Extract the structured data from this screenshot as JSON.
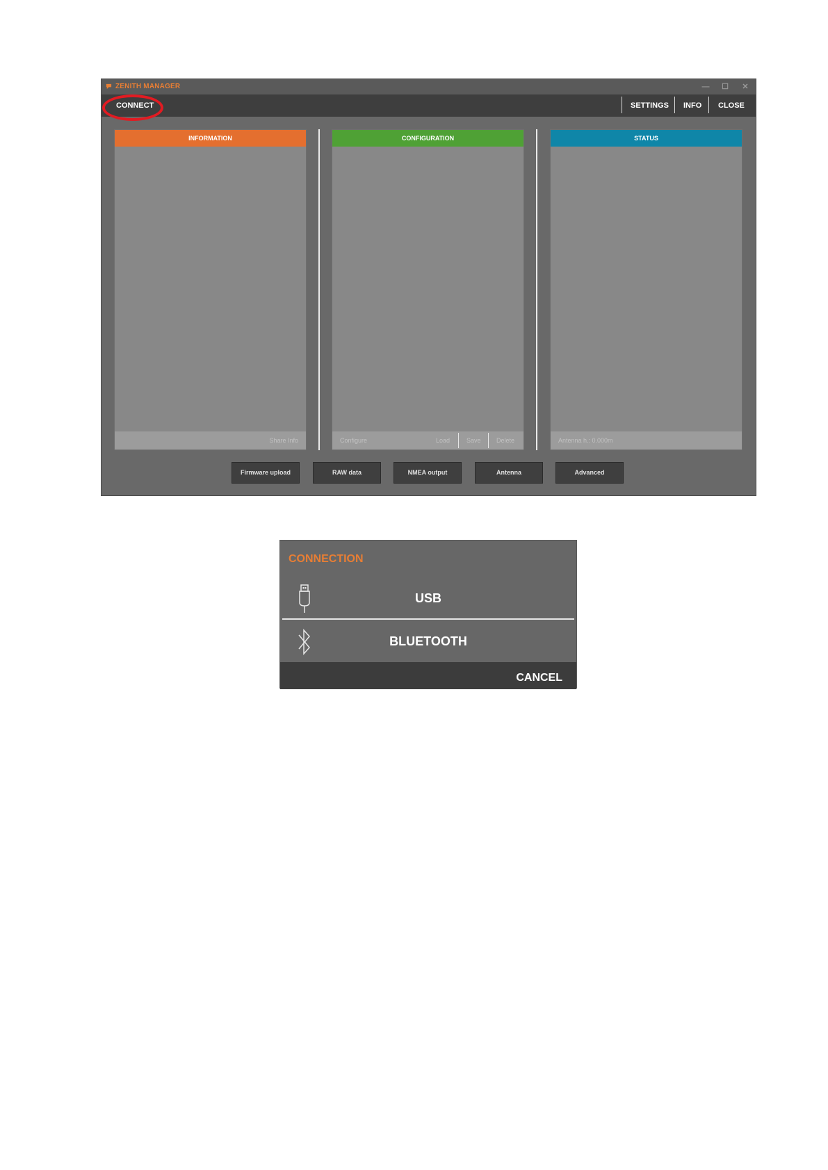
{
  "app": {
    "title": "ZENITH MANAGER",
    "controls": {
      "minimize": "—",
      "maximize": "☐",
      "close": "✕"
    }
  },
  "menubar": {
    "connect": "CONNECT",
    "settings": "SETTINGS",
    "info": "INFO",
    "close": "CLOSE"
  },
  "panels": {
    "information": {
      "title": "INFORMATION",
      "footer_share": "Share Info"
    },
    "configuration": {
      "title": "CONFIGURATION",
      "footer_configure": "Configure",
      "footer_load": "Load",
      "footer_save": "Save",
      "footer_delete": "Delete"
    },
    "status": {
      "title": "STATUS",
      "footer_antenna": "Antenna h.: 0.000m"
    }
  },
  "buttons": {
    "firmware_upload": "Firmware upload",
    "raw_data": "RAW data",
    "nmea_output": "NMEA output",
    "antenna": "Antenna",
    "advanced": "Advanced"
  },
  "dialog": {
    "title": "CONNECTION",
    "usb": "USB",
    "bluetooth": "BLUETOOTH",
    "cancel": "CANCEL"
  },
  "icons": {
    "app": "zenith-logo-icon",
    "usb": "usb-icon",
    "bluetooth": "bluetooth-icon"
  },
  "colors": {
    "accent": "#e87e34",
    "information_header": "#e46f2f",
    "configuration_header": "#4fa135",
    "status_header": "#0f86a8",
    "highlight": "#e11b22"
  }
}
